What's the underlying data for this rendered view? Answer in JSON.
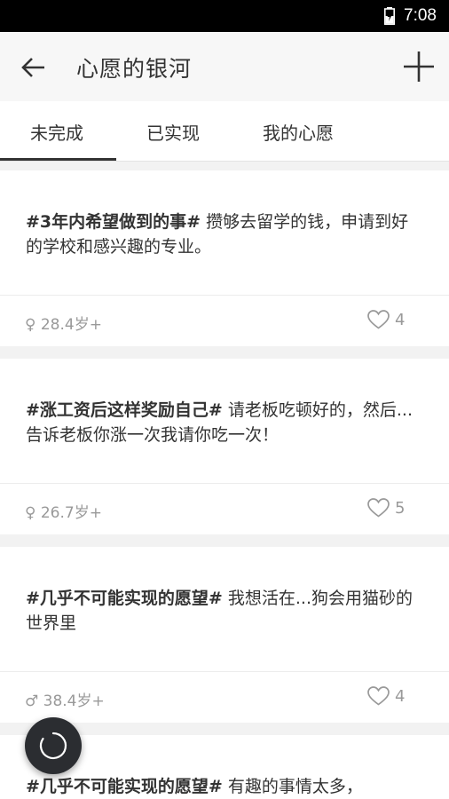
{
  "status": {
    "time": "7:08"
  },
  "header": {
    "title": "心愿的银河"
  },
  "tabs": [
    {
      "label": "未完成",
      "active": true
    },
    {
      "label": "已实现",
      "active": false
    },
    {
      "label": "我的心愿",
      "active": false
    }
  ],
  "wishes": [
    {
      "tag": "#3年内希望做到的事#",
      "body": " 攒够去留学的钱，申请到好的学校和感兴趣的专业。",
      "meta": "♀ 28.4岁+",
      "likes": "4"
    },
    {
      "tag": "#涨工资后这样奖励自己#",
      "body": " 请老板吃顿好的，然后...告诉老板你涨一次我请你吃一次！",
      "meta": "♀ 26.7岁+",
      "likes": "5"
    },
    {
      "tag": "#几乎不可能实现的愿望#",
      "body": " 我想活在...狗会用猫砂的世界里",
      "meta": "♂ 38.4岁+",
      "likes": "4"
    },
    {
      "tag": "#几乎不可能实现的愿望#",
      "body": " 有趣的事情太多，",
      "meta": "",
      "likes": ""
    }
  ],
  "colors": {
    "accent": "#333333",
    "fab": "#2b2d31",
    "background": "#f2f2f2"
  },
  "icons": {
    "back": "arrow-left-icon",
    "add": "plus-icon",
    "like": "heart-outline-icon",
    "fab": "refresh-icon",
    "battery": "battery-charging-icon"
  }
}
